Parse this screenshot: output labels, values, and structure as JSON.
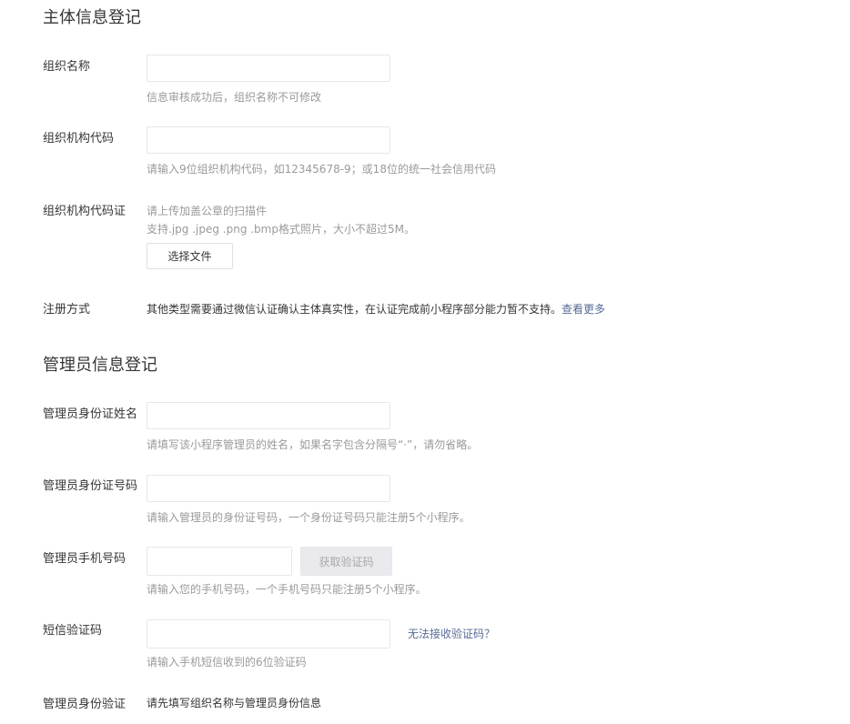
{
  "entity_section": {
    "title": "主体信息登记",
    "org_name": {
      "label": "组织名称",
      "value": "",
      "placeholder": "",
      "hint": "信息审核成功后，组织名称不可修改"
    },
    "org_code": {
      "label": "组织机构代码",
      "value": "",
      "placeholder": "",
      "hint": "请输入9位组织机构代码，如12345678-9；或18位的统一社会信用代码"
    },
    "org_cert": {
      "label": "组织机构代码证",
      "hint_line1": "请上传加盖公章的扫描件",
      "hint_line2": "支持.jpg .jpeg .png .bmp格式照片，大小不超过5M。",
      "button_label": "选择文件"
    },
    "register_method": {
      "label": "注册方式",
      "text": "其他类型需要通过微信认证确认主体真实性，在认证完成前小程序部分能力暂不支持。",
      "link": "查看更多"
    }
  },
  "admin_section": {
    "title": "管理员信息登记",
    "admin_name": {
      "label": "管理员身份证姓名",
      "value": "",
      "placeholder": "",
      "hint": "请填写该小程序管理员的姓名，如果名字包含分隔号“·”，请勿省略。"
    },
    "admin_id": {
      "label": "管理员身份证号码",
      "value": "",
      "placeholder": "",
      "hint": "请输入管理员的身份证号码，一个身份证号码只能注册5个小程序。"
    },
    "admin_phone": {
      "label": "管理员手机号码",
      "value": "",
      "placeholder": "",
      "button_label": "获取验证码",
      "hint": "请输入您的手机号码，一个手机号码只能注册5个小程序。"
    },
    "sms_code": {
      "label": "短信验证码",
      "value": "",
      "placeholder": "",
      "link": "无法接收验证码？",
      "hint": "请输入手机短信收到的6位验证码"
    },
    "admin_verify": {
      "label": "管理员身份验证",
      "text": "请先填写组织名称与管理员身份信息"
    }
  },
  "colors": {
    "link": "#576b95",
    "hint": "#9a9a9a",
    "text": "#353535",
    "input_border": "#e7e7eb",
    "disabled_button_bg": "#e9e9ee"
  }
}
